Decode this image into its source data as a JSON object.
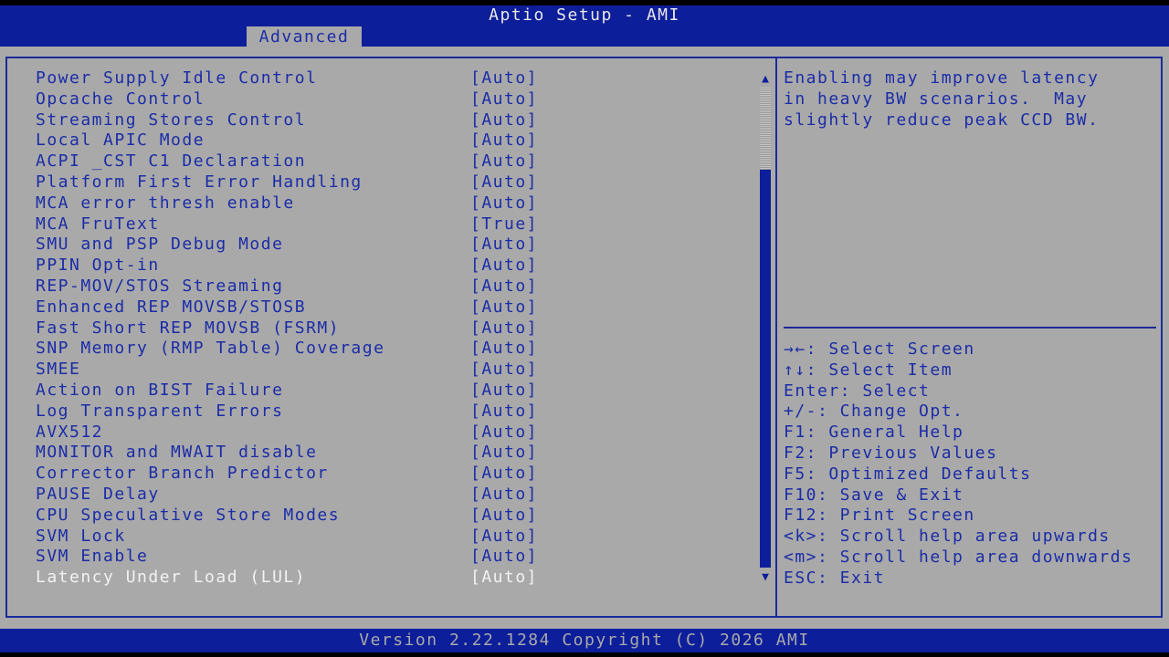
{
  "header": {
    "title": "Aptio Setup - AMI",
    "active_tab": "Advanced"
  },
  "settings": [
    {
      "label": "Power Supply Idle Control",
      "value": "[Auto]"
    },
    {
      "label": "Opcache Control",
      "value": "[Auto]"
    },
    {
      "label": "Streaming Stores Control",
      "value": "[Auto]"
    },
    {
      "label": "Local APIC Mode",
      "value": "[Auto]"
    },
    {
      "label": "ACPI _CST C1 Declaration",
      "value": "[Auto]"
    },
    {
      "label": "Platform First Error Handling",
      "value": "[Auto]"
    },
    {
      "label": "MCA error thresh enable",
      "value": "[Auto]"
    },
    {
      "label": "MCA FruText",
      "value": "[True]"
    },
    {
      "label": "SMU and PSP Debug Mode",
      "value": "[Auto]"
    },
    {
      "label": "PPIN Opt-in",
      "value": "[Auto]"
    },
    {
      "label": "REP-MOV/STOS Streaming",
      "value": "[Auto]"
    },
    {
      "label": "Enhanced REP MOVSB/STOSB",
      "value": "[Auto]"
    },
    {
      "label": "Fast Short REP MOVSB (FSRM)",
      "value": "[Auto]"
    },
    {
      "label": "SNP Memory (RMP Table) Coverage",
      "value": "[Auto]"
    },
    {
      "label": "SMEE",
      "value": "[Auto]"
    },
    {
      "label": "Action on BIST Failure",
      "value": "[Auto]"
    },
    {
      "label": "Log Transparent Errors",
      "value": "[Auto]"
    },
    {
      "label": "AVX512",
      "value": "[Auto]"
    },
    {
      "label": "MONITOR and MWAIT disable",
      "value": "[Auto]"
    },
    {
      "label": "Corrector Branch Predictor",
      "value": "[Auto]"
    },
    {
      "label": "PAUSE Delay",
      "value": "[Auto]"
    },
    {
      "label": "CPU Speculative Store Modes",
      "value": "[Auto]"
    },
    {
      "label": "SVM Lock",
      "value": "[Auto]"
    },
    {
      "label": "SVM Enable",
      "value": "[Auto]"
    },
    {
      "label": "Latency Under Load (LUL)",
      "value": "[Auto]"
    }
  ],
  "help": {
    "lines": [
      "Enabling may improve latency",
      "in heavy BW scenarios.  May",
      "slightly reduce peak CCD BW."
    ]
  },
  "keys": [
    "→←: Select Screen",
    "↑↓: Select Item",
    "Enter: Select",
    "+/-: Change Opt.",
    "F1: General Help",
    "F2: Previous Values",
    "F5: Optimized Defaults",
    "F10: Save & Exit",
    "F12: Print Screen",
    "<k>: Scroll help area upwards",
    "<m>: Scroll help area downwards",
    "ESC: Exit"
  ],
  "scrollbar": {
    "up_glyph": "▲",
    "down_glyph": "▼"
  },
  "footer": {
    "text": "Version 2.22.1284 Copyright (C) 2026 AMI"
  },
  "colors": {
    "background": "#a9a9a9",
    "bar": "#0d1e9a",
    "text": "#1b2ca8",
    "selected": "#f2f2f2"
  }
}
